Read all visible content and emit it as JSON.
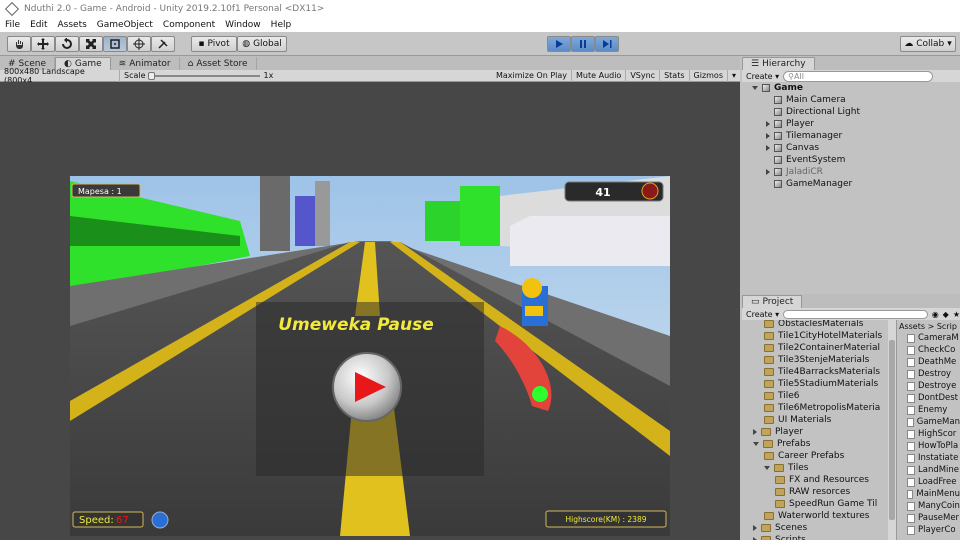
{
  "window_title": "Nduthi 2.0 - Game - Android - Unity 2019.2.10f1 Personal <DX11>",
  "menu": [
    "File",
    "Edit",
    "Assets",
    "GameObject",
    "Component",
    "Window",
    "Help"
  ],
  "toolbar": {
    "pivot": "Pivot",
    "global": "Global",
    "collab": "Collab"
  },
  "tabs": [
    "Scene",
    "Game",
    "Animator",
    "Asset Store"
  ],
  "gamebar": {
    "resolution": "800x480 Landscape (800x4",
    "scale_label": "Scale",
    "scale_value": "1x",
    "options": [
      "Maximize On Play",
      "Mute Audio",
      "VSync",
      "Stats",
      "Gizmos"
    ]
  },
  "hierarchy": {
    "tab": "Hierarchy",
    "create": "Create",
    "search_placeholder": "All",
    "root": "Game",
    "items": [
      {
        "label": "Main Camera",
        "expandable": false
      },
      {
        "label": "Directional Light",
        "expandable": false
      },
      {
        "label": "Player",
        "expandable": true
      },
      {
        "label": "Tilemanager",
        "expandable": true
      },
      {
        "label": "Canvas",
        "expandable": true
      },
      {
        "label": "EventSystem",
        "expandable": false
      },
      {
        "label": "JaladiCR",
        "expandable": true
      },
      {
        "label": "GameManager",
        "expandable": false
      }
    ]
  },
  "project": {
    "tab": "Project",
    "create": "Create",
    "breadcrumb": "Assets > Scrip",
    "tree": [
      {
        "label": "ObstaclesMaterials",
        "indent": 2
      },
      {
        "label": "Tile1CityHotelMaterials",
        "indent": 2
      },
      {
        "label": "Tile2ContainerMaterial",
        "indent": 2
      },
      {
        "label": "Tile3StenjeMaterials",
        "indent": 2
      },
      {
        "label": "Tile4BarracksMaterials",
        "indent": 2
      },
      {
        "label": "Tile5StadiumMaterials",
        "indent": 2
      },
      {
        "label": "Tile6",
        "indent": 2
      },
      {
        "label": "Tile6MetropolisMateria",
        "indent": 2
      },
      {
        "label": "UI Materials",
        "indent": 2
      },
      {
        "label": "Player",
        "indent": 1
      },
      {
        "label": "Prefabs",
        "indent": 1
      },
      {
        "label": "Career Prefabs",
        "indent": 2
      },
      {
        "label": "Tiles",
        "indent": 2
      },
      {
        "label": "FX and Resources",
        "indent": 3
      },
      {
        "label": "RAW resorces",
        "indent": 3
      },
      {
        "label": "SpeedRun Game Til",
        "indent": 3
      },
      {
        "label": "Waterworld textures",
        "indent": 2
      },
      {
        "label": "Scenes",
        "indent": 1
      },
      {
        "label": "Scripts",
        "indent": 1
      }
    ],
    "files": [
      "CameraM",
      "CheckCo",
      "DeathMe",
      "Destroy",
      "Destroye",
      "DontDest",
      "Enemy",
      "GameMan",
      "HighScor",
      "HowToPla",
      "Instatiate",
      "LandMine",
      "LoadFree",
      "MainMenu",
      "ManyCoin",
      "PauseMer",
      "PlayerCo"
    ]
  },
  "game": {
    "mapesa_label": "Mapesa : 1",
    "coins": "41",
    "pause_text": "Umeweka Pause",
    "speed_label": "Speed:",
    "speed_value": "67",
    "highscore": "Highscore(KM) : 2389"
  },
  "colors": {
    "accent": "#4a7cc0",
    "panel": "#c2c2c2",
    "game_bg": "#474747"
  }
}
